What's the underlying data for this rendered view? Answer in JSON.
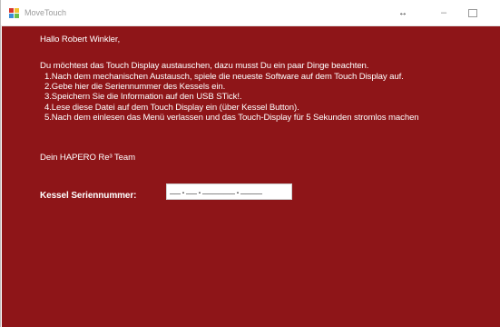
{
  "window": {
    "title": "MoveTouch",
    "resize_glyph": "↔",
    "minimize_glyph": "–"
  },
  "message": {
    "greeting": "Hallo Robert Winkler,",
    "intro": "Du möchtest das Touch Display austauschen, dazu musst Du ein paar Dinge beachten.",
    "steps": [
      "1.Nach dem mechanischen Austausch, spiele die neueste Software auf dem Touch Display auf.",
      "2.Gebe hier die Seriennummer des Kessels ein.",
      "3.Speichern Sie die Information auf den USB STick!.",
      "4.Lese diese Datei auf dem Touch Display ein (über Kessel Button).",
      "5.Nach dem einlesen das Menü verlassen und das Touch-Display für 5 Sekunden stromlos machen"
    ],
    "signature": "Dein HAPERO Re³ Team"
  },
  "form": {
    "serial_label": "Kessel Seriennummer:",
    "serial_value": "__.__.______.____"
  },
  "colors": {
    "background": "#8e1518",
    "text": "#ffffff"
  }
}
